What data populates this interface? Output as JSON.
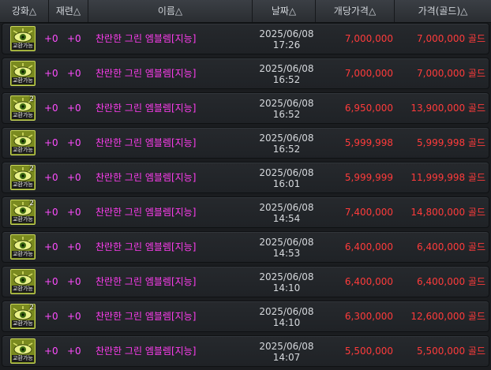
{
  "headers": {
    "enhance": "강화△",
    "refine": "재련△",
    "name": "이름△",
    "date": "날짜△",
    "unit_price": "개당가격△",
    "price_gold": "가격(골드)△"
  },
  "colors": {
    "item_name": "#ff3df0",
    "price": "#ff3b3b",
    "date": "#d6d9dd",
    "icon_bg": "#7a8a1f"
  },
  "rows": [
    {
      "icon": "eye-emblem-icon",
      "qty": "",
      "tag": "교환가능",
      "enhance": "+0",
      "refine": "+0",
      "name": "찬란한 그린 엠블렘[지능]",
      "date": "2025/06/08",
      "time": "17:26",
      "unit": "7,000,000",
      "total": "7,000,000 골드"
    },
    {
      "icon": "eye-emblem-icon",
      "qty": "",
      "tag": "교환가능",
      "enhance": "+0",
      "refine": "+0",
      "name": "찬란한 그린 엠블렘[지능]",
      "date": "2025/06/08",
      "time": "16:52",
      "unit": "7,000,000",
      "total": "7,000,000 골드"
    },
    {
      "icon": "eye-emblem-icon",
      "qty": "2",
      "tag": "교환가능",
      "enhance": "+0",
      "refine": "+0",
      "name": "찬란한 그린 엠블렘[지능]",
      "date": "2025/06/08",
      "time": "16:52",
      "unit": "6,950,000",
      "total": "13,900,000 골드"
    },
    {
      "icon": "eye-emblem-icon",
      "qty": "",
      "tag": "교환가능",
      "enhance": "+0",
      "refine": "+0",
      "name": "찬란한 그린 엠블렘[지능]",
      "date": "2025/06/08",
      "time": "16:52",
      "unit": "5,999,998",
      "total": "5,999,998 골드"
    },
    {
      "icon": "eye-emblem-icon",
      "qty": "2",
      "tag": "교환가능",
      "enhance": "+0",
      "refine": "+0",
      "name": "찬란한 그린 엠블렘[지능]",
      "date": "2025/06/08",
      "time": "16:01",
      "unit": "5,999,999",
      "total": "11,999,998 골드"
    },
    {
      "icon": "eye-emblem-icon",
      "qty": "2",
      "tag": "교환가능",
      "enhance": "+0",
      "refine": "+0",
      "name": "찬란한 그린 엠블렘[지능]",
      "date": "2025/06/08",
      "time": "14:54",
      "unit": "7,400,000",
      "total": "14,800,000 골드"
    },
    {
      "icon": "eye-emblem-icon",
      "qty": "",
      "tag": "교환가능",
      "enhance": "+0",
      "refine": "+0",
      "name": "찬란한 그린 엠블렘[지능]",
      "date": "2025/06/08",
      "time": "14:53",
      "unit": "6,400,000",
      "total": "6,400,000 골드"
    },
    {
      "icon": "eye-emblem-icon",
      "qty": "",
      "tag": "교환가능",
      "enhance": "+0",
      "refine": "+0",
      "name": "찬란한 그린 엠블렘[지능]",
      "date": "2025/06/08",
      "time": "14:10",
      "unit": "6,400,000",
      "total": "6,400,000 골드"
    },
    {
      "icon": "eye-emblem-icon",
      "qty": "2",
      "tag": "교환가능",
      "enhance": "+0",
      "refine": "+0",
      "name": "찬란한 그린 엠블렘[지능]",
      "date": "2025/06/08",
      "time": "14:10",
      "unit": "6,300,000",
      "total": "12,600,000 골드"
    },
    {
      "icon": "eye-emblem-icon",
      "qty": "",
      "tag": "교환가능",
      "enhance": "+0",
      "refine": "+0",
      "name": "찬란한 그린 엠블렘[지능]",
      "date": "2025/06/08",
      "time": "14:07",
      "unit": "5,500,000",
      "total": "5,500,000 골드"
    }
  ]
}
